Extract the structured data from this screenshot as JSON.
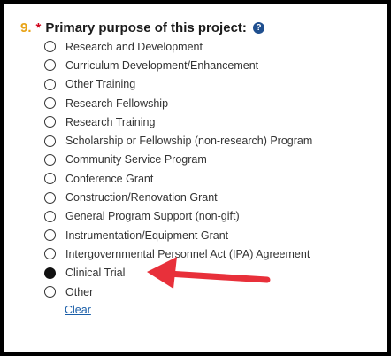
{
  "question": {
    "number": "9.",
    "required_mark": "*",
    "label": "Primary purpose of this project:",
    "help_icon": "question-circle-icon",
    "help_glyph": "?"
  },
  "options": [
    {
      "label": "Research and Development",
      "selected": false
    },
    {
      "label": "Curriculum Development/Enhancement",
      "selected": false
    },
    {
      "label": "Other Training",
      "selected": false
    },
    {
      "label": "Research Fellowship",
      "selected": false
    },
    {
      "label": "Research Training",
      "selected": false
    },
    {
      "label": "Scholarship or Fellowship (non-research) Program",
      "selected": false
    },
    {
      "label": "Community Service Program",
      "selected": false
    },
    {
      "label": "Conference Grant",
      "selected": false
    },
    {
      "label": "Construction/Renovation Grant",
      "selected": false
    },
    {
      "label": "General Program Support (non-gift)",
      "selected": false
    },
    {
      "label": "Instrumentation/Equipment Grant",
      "selected": false
    },
    {
      "label": "Intergovernmental Personnel Act (IPA) Agreement",
      "selected": false
    },
    {
      "label": "Clinical Trial",
      "selected": true
    },
    {
      "label": "Other",
      "selected": false
    }
  ],
  "clear_label": "Clear",
  "annotation": {
    "icon": "red-arrow-icon",
    "color": "#e8303a",
    "points_to": "Clinical Trial"
  },
  "colors": {
    "question_number": "#e8a317",
    "required": "#d0021b",
    "help": "#1f4f8f",
    "link": "#1a5ea8"
  }
}
